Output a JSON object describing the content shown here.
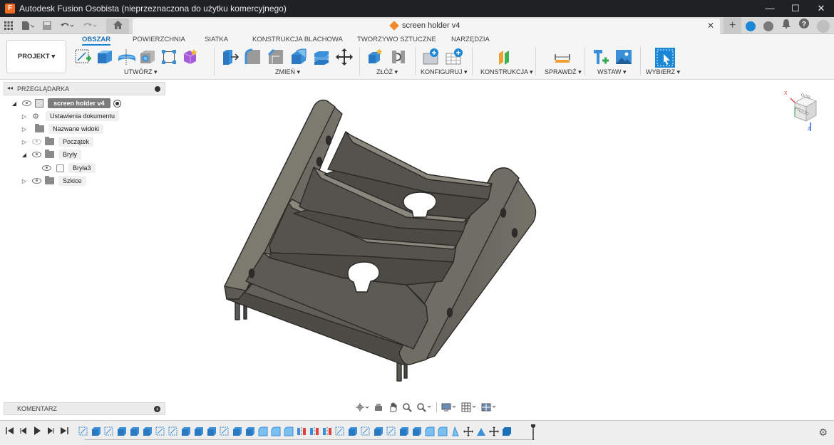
{
  "window": {
    "title": "Autodesk Fusion Osobista (nieprzeznaczona do użytku komercyjnego)",
    "controls": [
      "—",
      "☐",
      "✕"
    ]
  },
  "quick_access": {
    "document_tab": "screen holder v4",
    "close_symbol": "✕",
    "plus_symbol": "+"
  },
  "ribbon": {
    "tabs": [
      "OBSZAR",
      "POWIERZCHNIA",
      "SIATKA",
      "KONSTRUKCJA BLACHOWA",
      "TWORZYWO SZTUCZNE",
      "NARZĘDZIA"
    ],
    "project_button": "PROJEKT ▾",
    "groups": {
      "create": "UTWÓRZ ▾",
      "modify": "ZMIEŃ ▾",
      "assemble": "ZŁÓŻ ▾",
      "configure": "KONFIGURUJ ▾",
      "construct": "KONSTRUKCJA ▾",
      "inspect": "SPRAWDŹ ▾",
      "insert": "WSTAW ▾",
      "select": "WYBIERZ ▾"
    }
  },
  "browser": {
    "title": "PRZEGLĄDARKA",
    "root": "screen holder v4",
    "items": [
      {
        "label": "Ustawienia dokumentu"
      },
      {
        "label": "Nazwane widoki"
      },
      {
        "label": "Początek"
      },
      {
        "label": "Bryły"
      },
      {
        "label": "Bryła3"
      },
      {
        "label": "Szkice"
      }
    ]
  },
  "viewcube": {
    "top": "GÓR",
    "front": "PRZÓD",
    "axis_x": "X",
    "axis_z": "Z"
  },
  "comments": {
    "title": "KOMENTARZ",
    "plus_symbol": "+"
  },
  "colors": {
    "accent": "#1a86d6",
    "model_face": "#6e6b63",
    "model_edge": "#2a2a28",
    "titlebar": "#202124"
  },
  "timeline": {
    "feature_icons": [
      "sketch",
      "extrude",
      "sketch",
      "extrude",
      "extrude",
      "extrude",
      "sketch",
      "sketch",
      "extrude",
      "extrude",
      "extrude",
      "sketch",
      "extrude",
      "extrude",
      "fillet",
      "fillet",
      "fillet",
      "mirror",
      "mirror",
      "mirror",
      "sketch",
      "extrude",
      "sketch",
      "extrude",
      "sketch",
      "extrude",
      "extrude",
      "fillet",
      "fillet",
      "draft",
      "move",
      "chamfer",
      "move",
      "box"
    ]
  }
}
